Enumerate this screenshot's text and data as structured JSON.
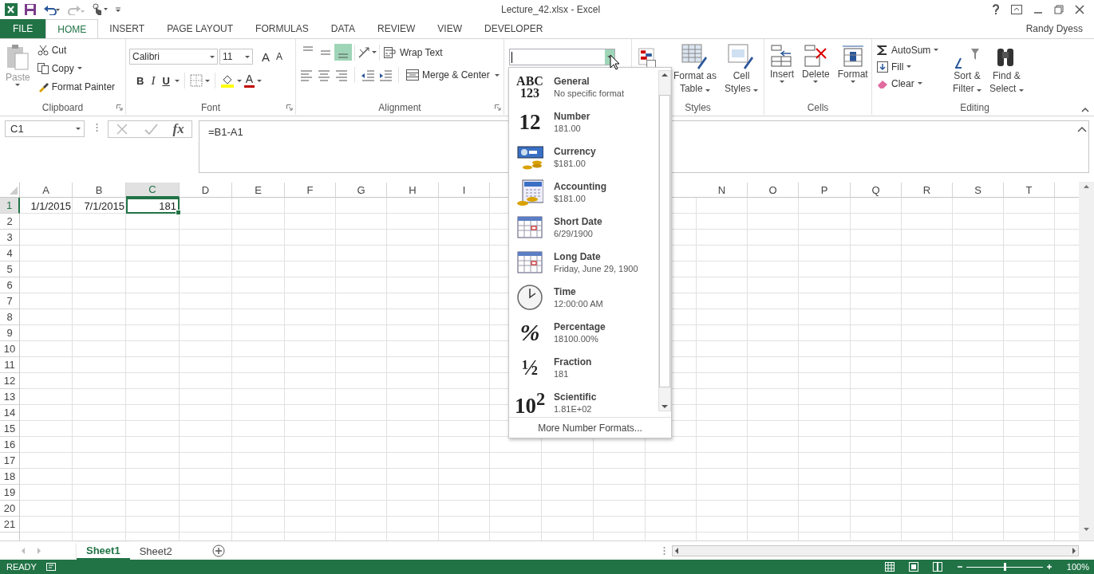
{
  "window": {
    "title": "Lecture_42.xlsx - Excel"
  },
  "tabs": [
    {
      "label": "FILE",
      "kind": "file",
      "selected": false
    },
    {
      "label": "HOME",
      "kind": "tab",
      "selected": true
    },
    {
      "label": "INSERT",
      "kind": "tab",
      "selected": false
    },
    {
      "label": "PAGE LAYOUT",
      "kind": "tab",
      "selected": false
    },
    {
      "label": "FORMULAS",
      "kind": "tab",
      "selected": false
    },
    {
      "label": "DATA",
      "kind": "tab",
      "selected": false
    },
    {
      "label": "REVIEW",
      "kind": "tab",
      "selected": false
    },
    {
      "label": "VIEW",
      "kind": "tab",
      "selected": false
    },
    {
      "label": "DEVELOPER",
      "kind": "tab",
      "selected": false
    }
  ],
  "user": {
    "name": "Randy Dyess"
  },
  "ribbon": {
    "clipboard": {
      "label": "Clipboard",
      "paste": {
        "label": "Paste",
        "disabled": true
      },
      "cut": "Cut",
      "copy": "Copy",
      "format_painter": "Format Painter"
    },
    "font": {
      "label": "Font",
      "font_name": "Calibri",
      "font_size": "11",
      "grow": "A",
      "shrink": "A",
      "bold": "B",
      "italic": "I",
      "underline": "U",
      "font_color": "A"
    },
    "alignment": {
      "label": "Alignment",
      "vertical": [
        {
          "kind": "top",
          "selected": false
        },
        {
          "kind": "middle",
          "selected": false
        },
        {
          "kind": "bottom",
          "selected": true
        }
      ],
      "wrap_text": "Wrap Text",
      "merge_center": "Merge & Center"
    },
    "styles": {
      "label": "Styles",
      "buttons": [
        {
          "kind": "table",
          "lines": [
            "Format as",
            "Table"
          ]
        },
        {
          "kind": "cell_styles",
          "lines": [
            "Cell",
            "Styles"
          ]
        }
      ]
    },
    "cells": {
      "label": "Cells",
      "buttons": [
        {
          "kind": "insert",
          "label": "Insert"
        },
        {
          "kind": "delete",
          "label": "Delete"
        },
        {
          "kind": "format",
          "label": "Format"
        }
      ]
    },
    "editing": {
      "label": "Editing",
      "autosum": "AutoSum",
      "fill": "Fill",
      "clear": "Clear",
      "buttons": [
        {
          "kind": "sort",
          "lines": [
            "Sort &",
            "Filter"
          ]
        },
        {
          "kind": "find",
          "lines": [
            "Find &",
            "Select"
          ]
        }
      ]
    }
  },
  "formula_bar": {
    "name_box": "C1",
    "function_label": "fx",
    "formula": "=B1-A1"
  },
  "sheet": {
    "columns": [
      {
        "label": "A",
        "selected": false
      },
      {
        "label": "B",
        "selected": false
      },
      {
        "label": "C",
        "selected": true
      },
      {
        "label": "D",
        "selected": false
      },
      {
        "label": "E",
        "selected": false
      },
      {
        "label": "F",
        "selected": false
      },
      {
        "label": "G",
        "selected": false
      },
      {
        "label": "H",
        "selected": false
      },
      {
        "label": "I",
        "selected": false
      },
      {
        "label": "N",
        "selected": false
      },
      {
        "label": "O",
        "selected": false
      },
      {
        "label": "P",
        "selected": false
      },
      {
        "label": "Q",
        "selected": false
      },
      {
        "label": "R",
        "selected": false
      },
      {
        "label": "S",
        "selected": false
      },
      {
        "label": "T",
        "selected": false
      }
    ],
    "rows": [
      {
        "label": "1",
        "selected": true,
        "cells": [
          {
            "value": "1/1/2015",
            "selected": false
          },
          {
            "value": "7/1/2015",
            "selected": false
          },
          {
            "value": "181",
            "selected": true
          }
        ]
      },
      {
        "label": "2",
        "selected": false
      },
      {
        "label": "3",
        "selected": false
      },
      {
        "label": "4",
        "selected": false
      },
      {
        "label": "5",
        "selected": false
      },
      {
        "label": "6",
        "selected": false
      },
      {
        "label": "7",
        "selected": false
      },
      {
        "label": "8",
        "selected": false
      },
      {
        "label": "9",
        "selected": false
      },
      {
        "label": "10",
        "selected": false
      },
      {
        "label": "11",
        "selected": false
      },
      {
        "label": "12",
        "selected": false
      },
      {
        "label": "13",
        "selected": false
      },
      {
        "label": "14",
        "selected": false
      },
      {
        "label": "15",
        "selected": false
      },
      {
        "label": "16",
        "selected": false
      },
      {
        "label": "17",
        "selected": false
      },
      {
        "label": "18",
        "selected": false
      },
      {
        "label": "19",
        "selected": false
      },
      {
        "label": "20",
        "selected": false
      },
      {
        "label": "21",
        "selected": false
      }
    ]
  },
  "number_format_menu": {
    "items": [
      {
        "kind": "general",
        "glyph": [
          "ABC",
          "123"
        ],
        "name": "General",
        "example": "No specific format"
      },
      {
        "kind": "number",
        "glyph": [
          "12"
        ],
        "name": "Number",
        "example": "181.00"
      },
      {
        "kind": "currency",
        "name": "Currency",
        "example": "$181.00"
      },
      {
        "kind": "accounting",
        "name": "Accounting",
        "example": "$181.00"
      },
      {
        "kind": "short_date",
        "name": "Short Date",
        "example": "6/29/1900"
      },
      {
        "kind": "long_date",
        "name": "Long Date",
        "example": "Friday, June 29, 1900"
      },
      {
        "kind": "time",
        "name": "Time",
        "example": "12:00:00 AM"
      },
      {
        "kind": "percentage",
        "glyph": [
          "%"
        ],
        "name": "Percentage",
        "example": "18100.00%"
      },
      {
        "kind": "fraction",
        "glyph": [
          "½"
        ],
        "name": "Fraction",
        "example": "181"
      },
      {
        "kind": "scientific",
        "glyph": [
          "10$^{2}$"
        ],
        "name": "Scientific",
        "example": "1.81E+02"
      }
    ],
    "footer": "More Number Formats..."
  },
  "sheet_tabs": [
    {
      "label": "Sheet1",
      "selected": true
    },
    {
      "label": "Sheet2",
      "selected": false
    }
  ],
  "status_bar": {
    "status": "READY",
    "zoom": "100%",
    "zoom_slider": {
      "level": 0.5
    }
  }
}
